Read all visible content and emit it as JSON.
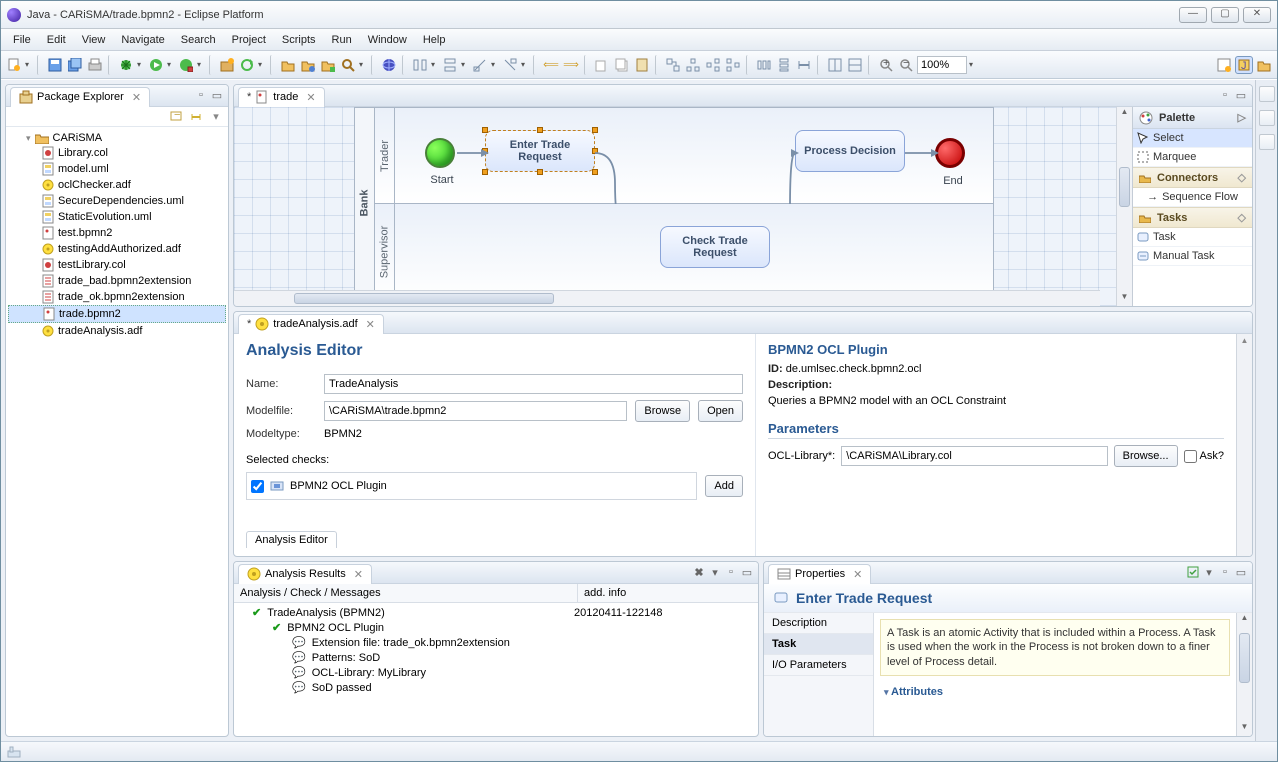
{
  "window": {
    "title": "Java - CARiSMA/trade.bpmn2 - Eclipse Platform"
  },
  "menu": [
    "File",
    "Edit",
    "View",
    "Navigate",
    "Search",
    "Project",
    "Scripts",
    "Run",
    "Window",
    "Help"
  ],
  "zoom_value": "100%",
  "package_explorer": {
    "title": "Package Explorer",
    "project": "CARiSMA",
    "files": [
      "Library.col",
      "model.uml",
      "oclChecker.adf",
      "SecureDependencies.uml",
      "StaticEvolution.uml",
      "test.bpmn2",
      "testingAddAuthorized.adf",
      "testLibrary.col",
      "trade_bad.bpmn2extension",
      "trade_ok.bpmn2extension",
      "trade.bpmn2",
      "tradeAnalysis.adf"
    ],
    "selected": "trade.bpmn2"
  },
  "editor": {
    "tab_label": "trade",
    "modified": true,
    "pool": "Bank",
    "lanes": [
      "Trader",
      "Supervisor"
    ],
    "start_label": "Start",
    "end_label": "End",
    "tasks": {
      "enter_trade": "Enter Trade Request",
      "check_trade": "Check Trade Request",
      "process_decision": "Process Decision"
    }
  },
  "palette": {
    "title": "Palette",
    "select": "Select",
    "marquee": "Marquee",
    "connectors": "Connectors",
    "sequence_flow": "Sequence Flow",
    "tasks_drawer": "Tasks",
    "task": "Task",
    "manual_task": "Manual Task"
  },
  "analysis_editor": {
    "tab_label": "tradeAnalysis.adf",
    "modified": true,
    "title": "Analysis Editor",
    "name_label": "Name:",
    "name_value": "TradeAnalysis",
    "modelfile_label": "Modelfile:",
    "modelfile_value": "\\CARiSMA\\trade.bpmn2",
    "browse": "Browse",
    "open": "Open",
    "modeltype_label": "Modeltype:",
    "modeltype_value": "BPMN2",
    "selected_checks_label": "Selected checks:",
    "check_item": "BPMN2 OCL Plugin",
    "add": "Add",
    "footer_tab": "Analysis Editor",
    "plugin_title": "BPMN2 OCL Plugin",
    "id_label": "ID:",
    "id_value": "de.umlsec.check.bpmn2.ocl",
    "desc_label": "Description:",
    "desc_value": "Queries a BPMN2 model with an OCL Constraint",
    "params_title": "Parameters",
    "ocl_lib_label": "OCL-Library*:",
    "ocl_lib_value": "\\CARiSMA\\Library.col",
    "browse2": "Browse...",
    "ask": "Ask?"
  },
  "results": {
    "title": "Analysis Results",
    "col1": "Analysis / Check / Messages",
    "col2": "add. info",
    "root": "TradeAnalysis (BPMN2)",
    "root_info": "20120411-122148",
    "plugin": "BPMN2 OCL Plugin",
    "msgs": [
      "Extension file: trade_ok.bpmn2extension",
      "Patterns: SoD",
      "OCL-Library: MyLibrary",
      "SoD passed"
    ]
  },
  "properties": {
    "title": "Properties",
    "element_title": "Enter Trade Request",
    "tabs": [
      "Description",
      "Task",
      "I/O Parameters"
    ],
    "active_tab": "Task",
    "desc": "A Task is an atomic Activity that is included within a Process. A Task is used when the work in the Process is not broken down to a finer level of Process detail.",
    "attributes": "Attributes"
  }
}
